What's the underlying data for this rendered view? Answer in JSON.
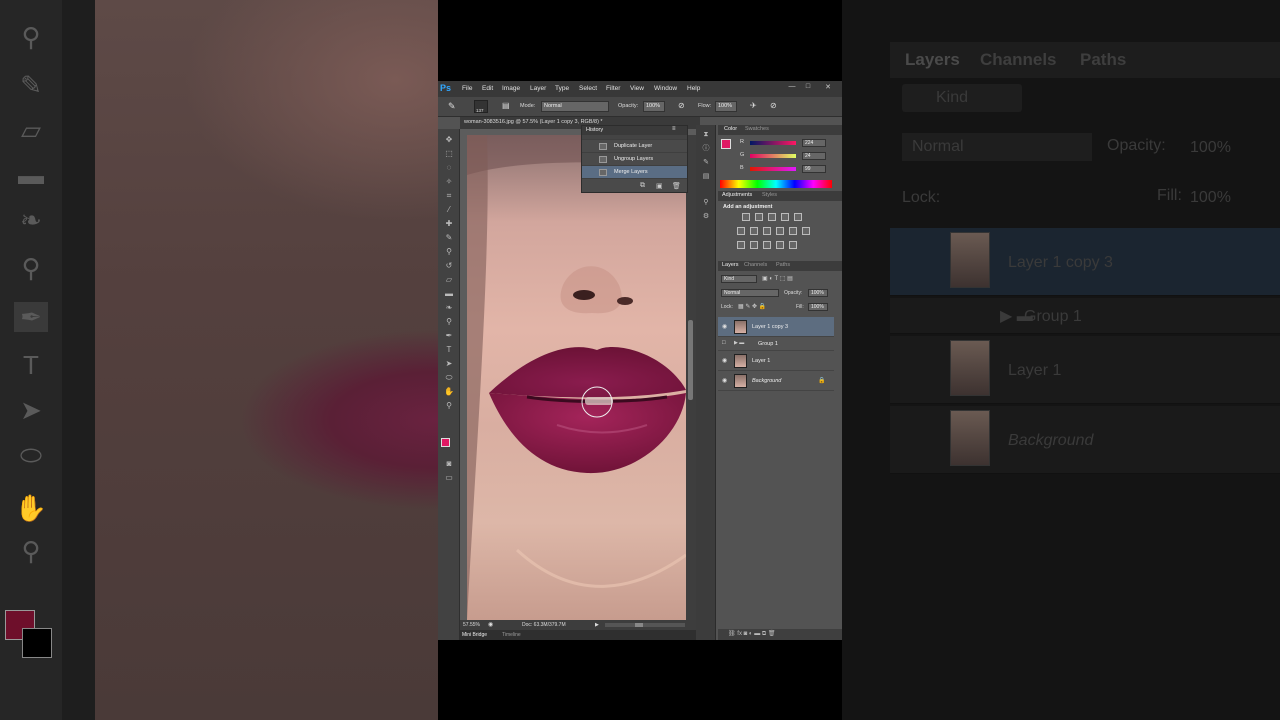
{
  "app": {
    "logo": "Ps"
  },
  "menu": [
    "File",
    "Edit",
    "Image",
    "Layer",
    "Type",
    "Select",
    "Filter",
    "View",
    "Window",
    "Help"
  ],
  "window_buttons": [
    "—",
    "□",
    "✕"
  ],
  "options_bar": {
    "brush_size": "137",
    "mode_label": "Mode:",
    "mode_value": "Normal",
    "opacity_label": "Opacity:",
    "opacity_value": "100%",
    "flow_label": "Flow:",
    "flow_value": "100%"
  },
  "document": {
    "tab_title": "woman-3083516.jpg @ 57.5% (Layer 1 copy 3, RGB/8) *",
    "zoom": "57.55%",
    "doc_size": "Doc: 63.3M/379.7M"
  },
  "bottom_tabs": [
    "Mini Bridge",
    "Timeline"
  ],
  "history": {
    "title": "History",
    "items": [
      {
        "label": "Duplicate Layer",
        "selected": false
      },
      {
        "label": "Ungroup Layers",
        "selected": false
      },
      {
        "label": "Merge Layers",
        "selected": true
      }
    ]
  },
  "color_panel": {
    "tabs": [
      "Color",
      "Swatches"
    ],
    "r": {
      "label": "R",
      "value": "224"
    },
    "g": {
      "label": "G",
      "value": "24"
    },
    "b": {
      "label": "B",
      "value": "99"
    },
    "foreground": "#e01863",
    "background": "#000000"
  },
  "adjustments": {
    "tabs": [
      "Adjustments",
      "Styles"
    ],
    "heading": "Add an adjustment"
  },
  "layers_panel": {
    "tabs": [
      "Layers",
      "Channels",
      "Paths"
    ],
    "kind_label": "Kind",
    "blend_mode": "Normal",
    "opacity_label": "Opacity:",
    "opacity_value": "100%",
    "lock_label": "Lock:",
    "fill_label": "Fill:",
    "fill_value": "100%",
    "layers": [
      {
        "name": "Layer 1 copy 3",
        "selected": true,
        "visible": true
      },
      {
        "name": "Group 1",
        "selected": false,
        "visible": false,
        "is_group": true
      },
      {
        "name": "Layer 1",
        "selected": false,
        "visible": true
      },
      {
        "name": "Background",
        "selected": false,
        "visible": true,
        "locked": true
      }
    ]
  },
  "bg_right": {
    "tabs": [
      "Layers",
      "Channels",
      "Paths"
    ],
    "kind_label": "Kind",
    "blend_mode": "Normal",
    "opacity_label": "Opacity:",
    "opacity_value": "100%",
    "lock_label": "Lock:",
    "fill_label": "Fill:",
    "fill_value": "100%",
    "layers": [
      "Layer 1 copy 3",
      "Group 1",
      "Layer 1",
      "Background"
    ]
  }
}
